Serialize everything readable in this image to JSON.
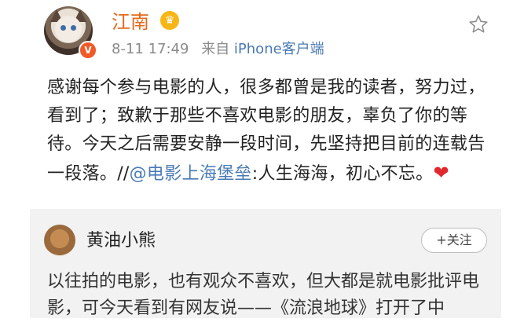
{
  "post": {
    "username": "江南",
    "date": "8-11 17:49",
    "source_prefix": "来自",
    "source": "iPhone客户端",
    "content_before": "感谢每个参与电影的人，很多都曾是我的读者，努力过，看到了；致歉于那些不喜欢电影的朋友，辜负了你的等待。今天之后需要安静一段时间，先坚持把目前的连载告一段落。//",
    "mention": "@电影上海堡垒",
    "content_after": ":人生海海，初心不忘。",
    "heart": "❤",
    "verified_badge": "V"
  },
  "repost": {
    "username": "黄油小熊",
    "follow_label": "+关注",
    "text": "以往拍的电影，也有观众不喜欢，但大都是就电影批评电影，可今天看到有网友说——《流浪地球》打开了中"
  },
  "colors": {
    "accent": "#e46a1c",
    "link": "#4a7ab5",
    "heart": "#e0282e"
  }
}
